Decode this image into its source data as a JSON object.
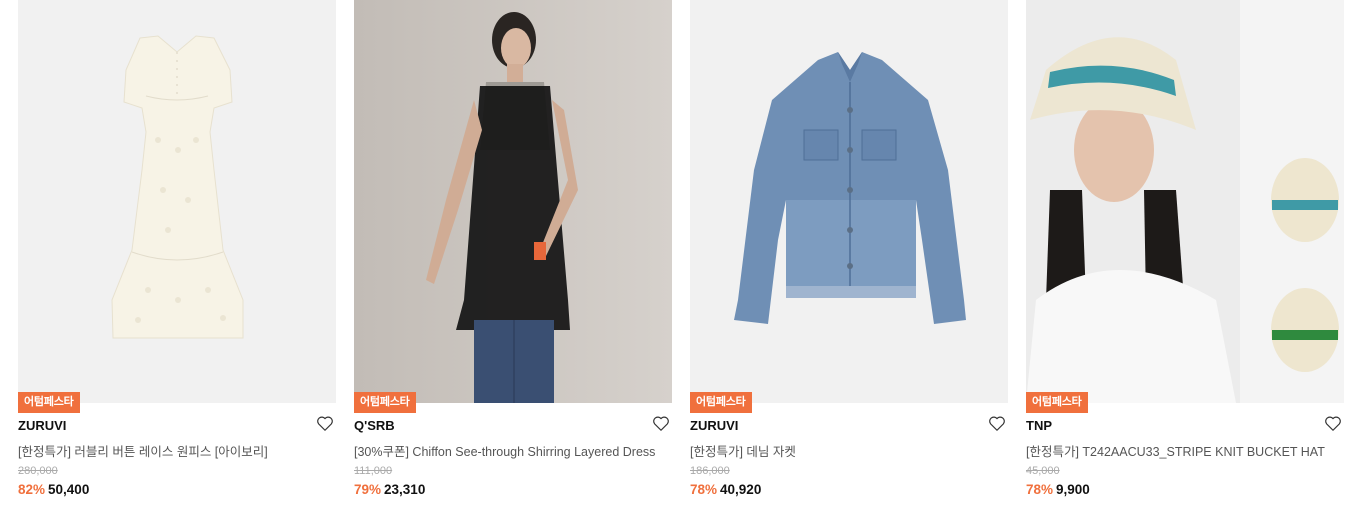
{
  "products": [
    {
      "badge": "어텀페스타",
      "brand": "ZURUVI",
      "title": "[한정특가] 러블리 버튼 레이스 원피스 [아이보리]",
      "original_price": "280,000",
      "discount": "82%",
      "sale_price": "50,400",
      "image": "ivory-lace-dress"
    },
    {
      "badge": "어텀페스타",
      "brand": "Q'SRB",
      "title": "[30%쿠폰] Chiffon See-through Shirring Layered Dress",
      "original_price": "111,000",
      "discount": "79%",
      "sale_price": "23,310",
      "image": "model-black-chiffon-dress"
    },
    {
      "badge": "어텀페스타",
      "brand": "ZURUVI",
      "title": "[한정특가] 데님 자켓",
      "original_price": "186,000",
      "discount": "78%",
      "sale_price": "40,920",
      "image": "denim-jacket"
    },
    {
      "badge": "어텀페스타",
      "brand": "TNP",
      "title": "[한정특가] T242AACU33_STRIPE KNIT BUCKET HAT",
      "original_price": "45,000",
      "discount": "78%",
      "sale_price": "9,900",
      "image": "model-knit-bucket-hat"
    }
  ],
  "colors": {
    "accent": "#f0703d",
    "badge_text": "#ffffff",
    "title_text": "#555555",
    "original_price": "#aaaaaa"
  },
  "icons": {
    "wishlist": "heart-outline-icon"
  }
}
